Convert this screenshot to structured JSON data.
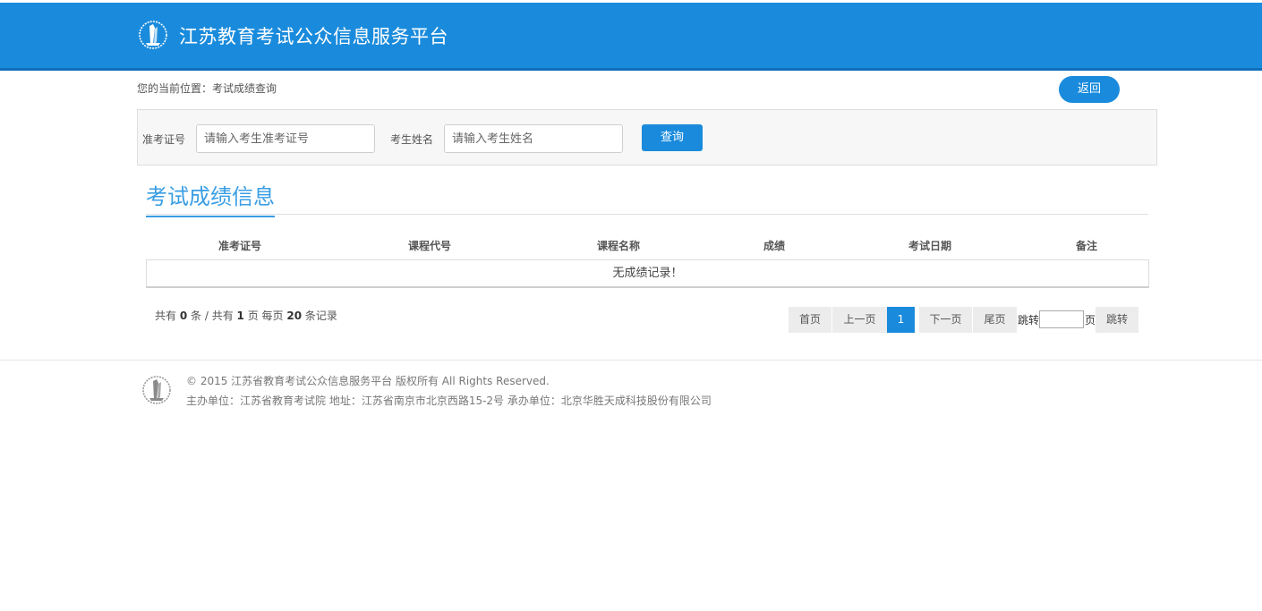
{
  "header": {
    "site_title": "江苏教育考试公众信息服务平台",
    "logo_icon": "torch-emblem-icon",
    "bg_color": "#1a8bdc"
  },
  "breadcrumb": {
    "text": "您的当前位置：考试成绩查询"
  },
  "back_button": {
    "label": "返回"
  },
  "search": {
    "id_label": "准考证号",
    "id_placeholder": "请输入考生准考证号",
    "name_label": "考生姓名",
    "name_placeholder": "请输入考生姓名",
    "query_label": "查询"
  },
  "section": {
    "title": "考试成绩信息"
  },
  "table": {
    "columns": [
      "准考证号",
      "课程代号",
      "课程名称",
      "成绩",
      "考试日期",
      "备注"
    ],
    "empty_message": "无成绩记录！"
  },
  "pager": {
    "prefix": "共有",
    "total_records": "0",
    "records_unit": "条 / 共有",
    "total_pages": "1",
    "pages_unit": "页 每页",
    "per_page": "20",
    "per_page_unit": "条记录",
    "first": "首页",
    "prev": "上一页",
    "current": "1",
    "next": "下一页",
    "last": "尾页",
    "jump_prefix": "跳转",
    "jump_suffix": "页",
    "jump_button": "跳转"
  },
  "footer": {
    "copyright": "© 2015 江苏省教育考试公众信息服务平台 版权所有 All Rights Reserved.",
    "org_info": "主办单位：江苏省教育考试院 地址：江苏省南京市北京西路15-2号 承办单位：北京华胜天成科技股份有限公司",
    "logo_icon": "torch-emblem-icon"
  }
}
